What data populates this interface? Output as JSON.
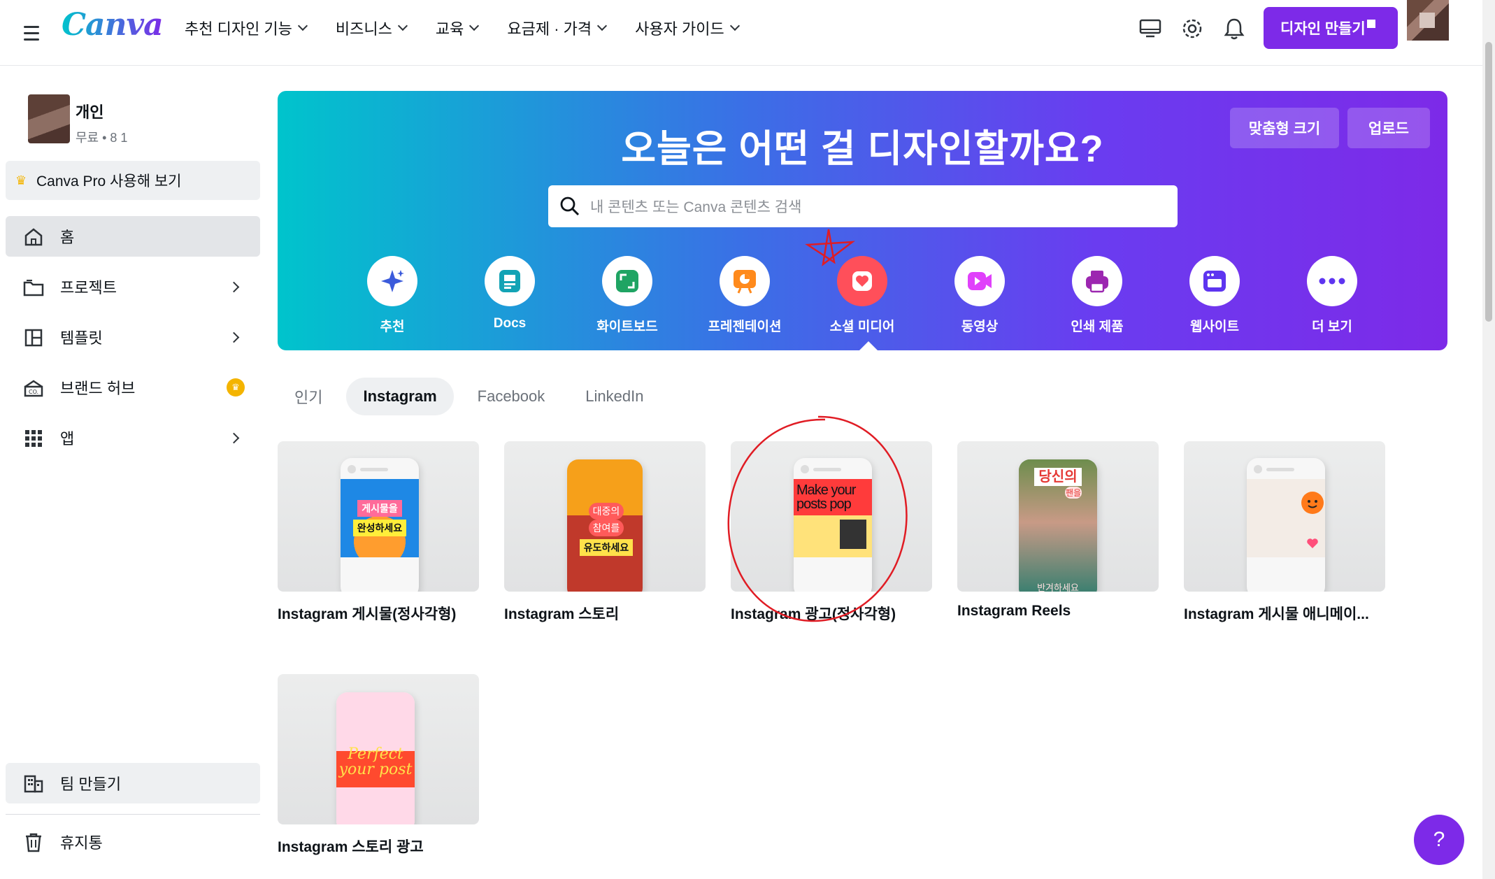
{
  "header": {
    "logo": "Canva",
    "nav": [
      "추천 디자인 기능",
      "비즈니스",
      "교육",
      "요금제 · 가격",
      "사용자 가이드"
    ],
    "create_label": "디자인 만들기"
  },
  "sidebar": {
    "team_name": "개인",
    "team_sub": "무료 • 8 1",
    "pro_label": "Canva Pro 사용해 보기",
    "items": [
      {
        "label": "홈"
      },
      {
        "label": "프로젝트"
      },
      {
        "label": "템플릿"
      },
      {
        "label": "브랜드 허브"
      },
      {
        "label": "앱"
      }
    ],
    "team_btn": "팀 만들기",
    "trash": "휴지통"
  },
  "hero": {
    "title": "오늘은 어떤 걸 디자인할까요?",
    "custom_size": "맞춤형 크기",
    "upload": "업로드",
    "search_placeholder": "내 콘텐츠 또는 Canva 콘텐츠 검색",
    "categories": [
      "추천",
      "Docs",
      "화이트보드",
      "프레젠테이션",
      "소셜 미디어",
      "동영상",
      "인쇄 제품",
      "웹사이트",
      "더 보기"
    ]
  },
  "tabs": [
    "인기",
    "Instagram",
    "Facebook",
    "LinkedIn"
  ],
  "cards": [
    {
      "title": "Instagram 게시물(정사각형)",
      "screen": [
        "게시물을",
        "완성하세요"
      ]
    },
    {
      "title": "Instagram 스토리",
      "screen": [
        "대중의",
        "참여를",
        "유도하세요"
      ]
    },
    {
      "title": "Instagram 광고(정사각형)",
      "screen": [
        "Make your",
        "posts pop"
      ]
    },
    {
      "title": "Instagram Reels",
      "screen": [
        "당신의",
        "팬을",
        "반겨하세요"
      ]
    },
    {
      "title": "Instagram 게시물 애니메이..."
    },
    {
      "title": "Instagram 스토리 광고",
      "screen": [
        "Perfect",
        "your post"
      ]
    }
  ],
  "help": "?"
}
